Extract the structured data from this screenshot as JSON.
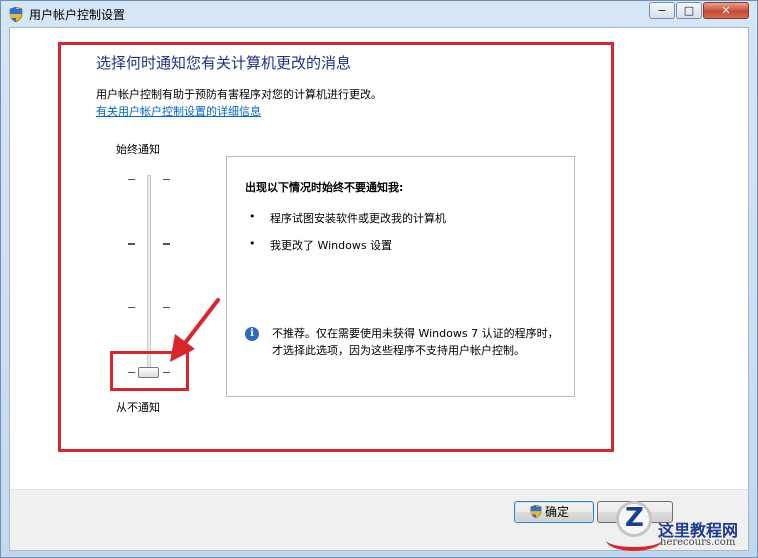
{
  "window": {
    "title": "用户帐户控制设置"
  },
  "caption_buttons": {
    "minimize": "−",
    "maximize": "□",
    "close": "✕"
  },
  "main": {
    "heading": "选择何时通知您有关计算机更改的消息",
    "description": "用户帐户控制有助于预防有害程序对您的计算机进行更改。",
    "link": "有关用户帐户控制设置的详细信息"
  },
  "slider": {
    "top_label": "始终通知",
    "bottom_label": "从不通知",
    "levels": 4,
    "selected_level": 1
  },
  "info": {
    "title": "出现以下情况时始终不要通知我:",
    "bullets": [
      "程序试图安装软件或更改我的计算机",
      "我更改了 Windows 设置"
    ],
    "note": "不推荐。仅在需要使用未获得 Windows 7 认证的程序时，才选择此选项，因为这些程序不支持用户帐户控制。"
  },
  "footer": {
    "ok_label": "确定",
    "cancel_label": "取消"
  },
  "watermark": {
    "brand": "这里教程网",
    "domain": "herecours.com"
  },
  "colors": {
    "heading": "#1e3287",
    "link": "#0066cc",
    "annotation": "#d9262c"
  }
}
